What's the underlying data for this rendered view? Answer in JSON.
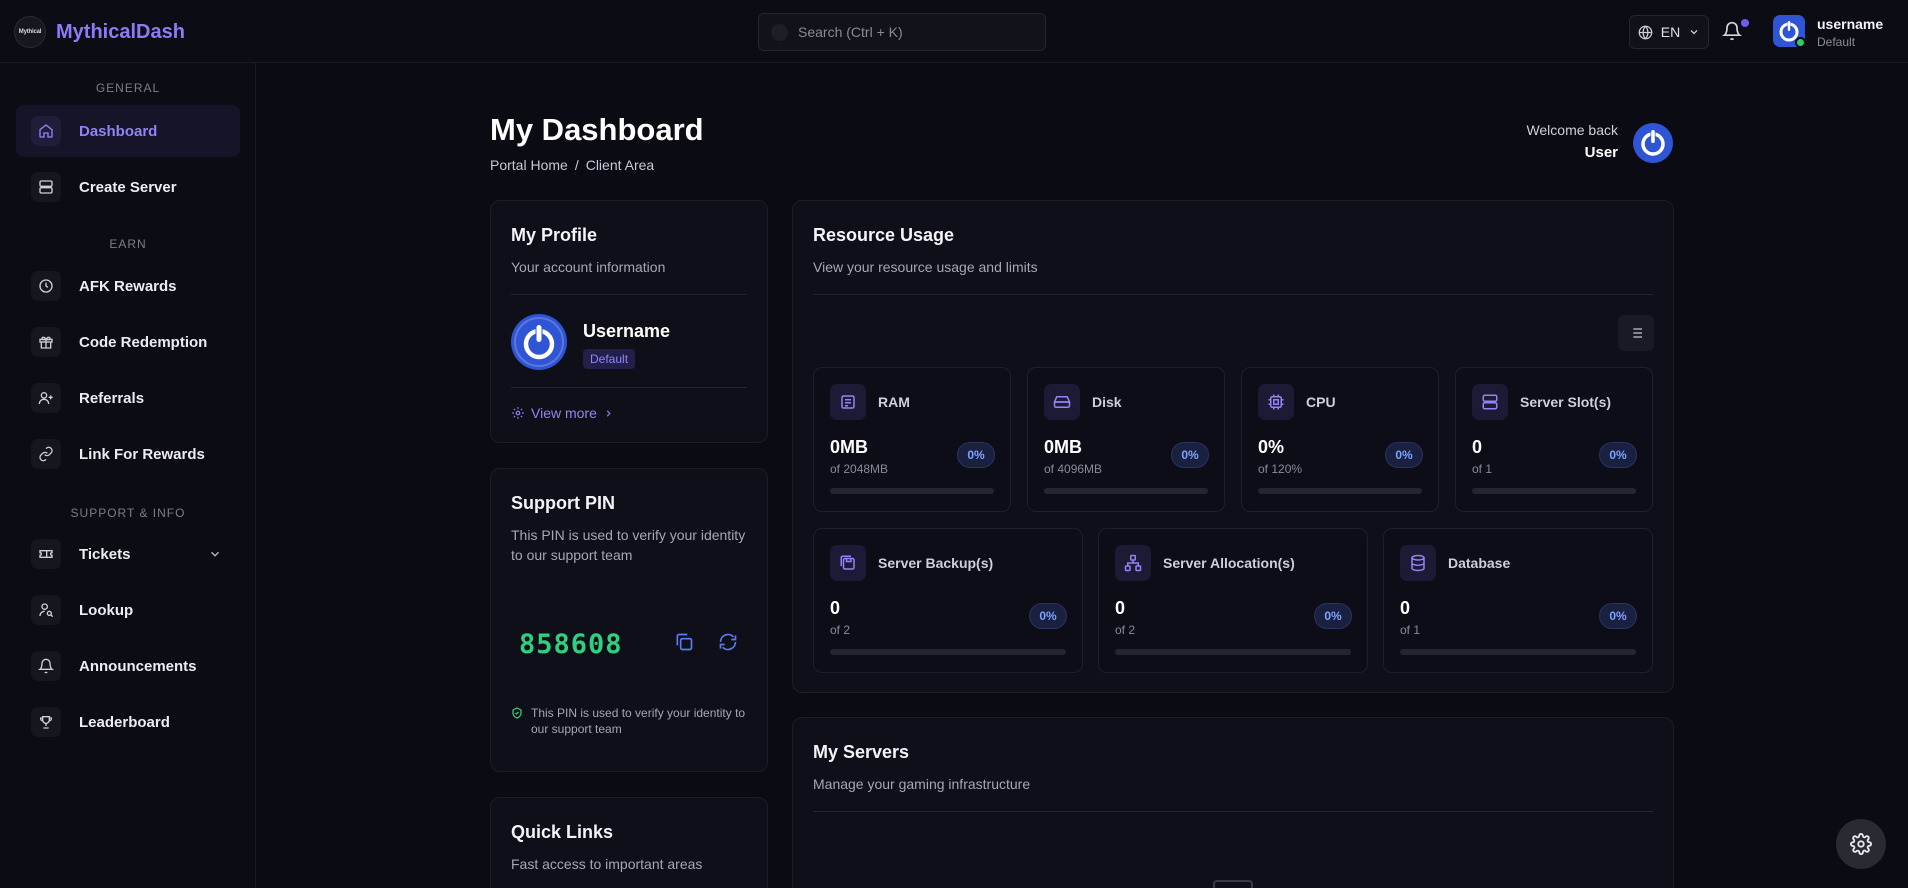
{
  "app": {
    "logo_text": "Mythical",
    "name": "MythicalDash"
  },
  "search": {
    "placeholder": "Search (Ctrl + K)"
  },
  "header": {
    "language": "EN",
    "username": "username",
    "role": "Default"
  },
  "sidebar": {
    "sections": [
      {
        "label": "GENERAL",
        "items": [
          {
            "label": "Dashboard",
            "icon": "home-icon",
            "active": true
          },
          {
            "label": "Create Server",
            "icon": "server-icon"
          }
        ]
      },
      {
        "label": "EARN",
        "items": [
          {
            "label": "AFK Rewards",
            "icon": "clock-icon"
          },
          {
            "label": "Code Redemption",
            "icon": "gift-icon"
          },
          {
            "label": "Referrals",
            "icon": "user-plus-icon"
          },
          {
            "label": "Link For Rewards",
            "icon": "link-icon"
          }
        ]
      },
      {
        "label": "SUPPORT & INFO",
        "items": [
          {
            "label": "Tickets",
            "icon": "ticket-icon",
            "expandable": true
          },
          {
            "label": "Lookup",
            "icon": "user-search-icon"
          },
          {
            "label": "Announcements",
            "icon": "bell-icon"
          },
          {
            "label": "Leaderboard",
            "icon": "trophy-icon"
          }
        ]
      }
    ]
  },
  "page": {
    "title": "My Dashboard",
    "breadcrumb": [
      "Portal Home",
      "/",
      "Client Area"
    ],
    "welcome_label": "Welcome back",
    "welcome_name": "User"
  },
  "profile": {
    "title": "My Profile",
    "subtitle": "Your account information",
    "username": "Username",
    "badge": "Default",
    "view_more": "View more"
  },
  "support_pin": {
    "title": "Support PIN",
    "subtitle": "This PIN is used to verify your identity to our support team",
    "pin": "858608",
    "note": "This PIN is used to verify your identity to our support team"
  },
  "quick_links": {
    "title": "Quick Links",
    "subtitle": "Fast access to important areas"
  },
  "resource_usage": {
    "title": "Resource Usage",
    "subtitle": "View your resource usage and limits",
    "stats": [
      {
        "label": "RAM",
        "value": "0MB",
        "of": "of 2048MB",
        "percent": "0%",
        "fill": 0
      },
      {
        "label": "Disk",
        "value": "0MB",
        "of": "of 4096MB",
        "percent": "0%",
        "fill": 0
      },
      {
        "label": "CPU",
        "value": "0%",
        "of": "of 120%",
        "percent": "0%",
        "fill": 0
      },
      {
        "label": "Server Slot(s)",
        "value": "0",
        "of": "of 1",
        "percent": "0%",
        "fill": 0
      },
      {
        "label": "Server Backup(s)",
        "value": "0",
        "of": "of 2",
        "percent": "0%",
        "fill": 0
      },
      {
        "label": "Server Allocation(s)",
        "value": "0",
        "of": "of 2",
        "percent": "0%",
        "fill": 0
      },
      {
        "label": "Database",
        "value": "0",
        "of": "of 1",
        "percent": "0%",
        "fill": 0
      }
    ]
  },
  "my_servers": {
    "title": "My Servers",
    "subtitle": "Manage your gaming infrastructure"
  },
  "colors": {
    "accent": "#8b7cf6",
    "pin": "#2fd17f",
    "avatar_blue": "#2f55d4",
    "online": "#2ecc71"
  }
}
